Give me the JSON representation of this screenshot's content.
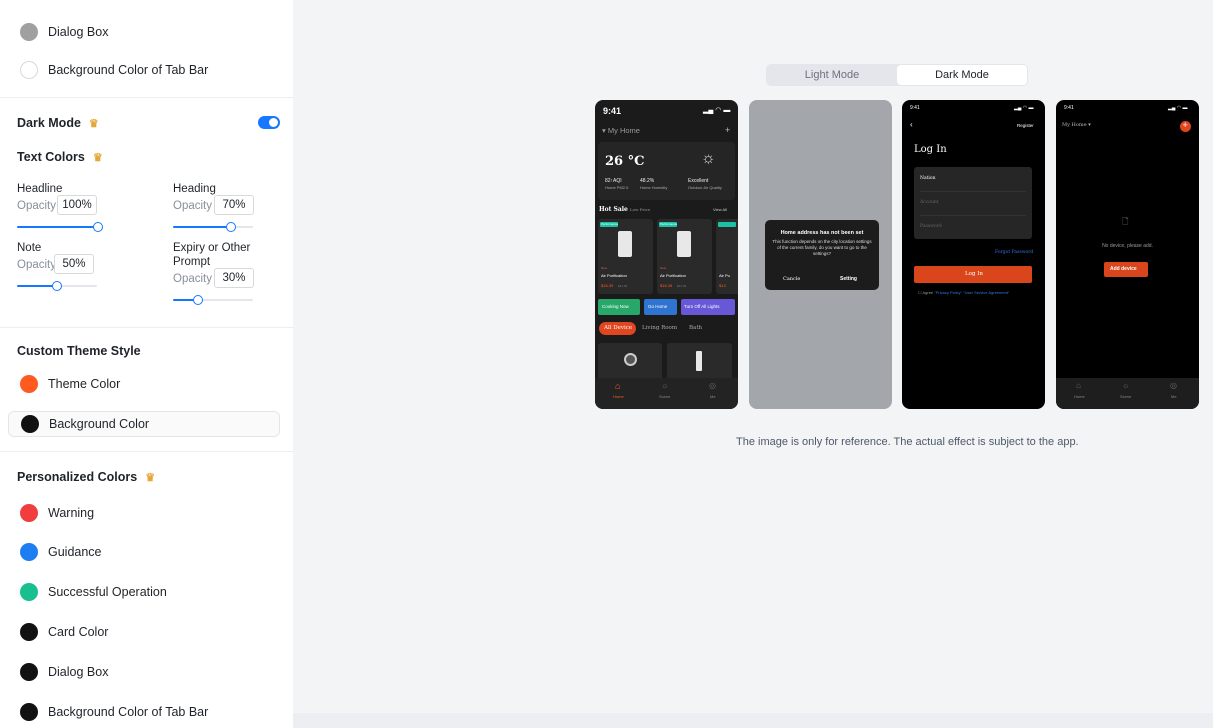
{
  "colors": {
    "accent": "#1677ff",
    "theme": "#ff5a1f",
    "warning": "#f03e3e",
    "guidance": "#1c7ef2",
    "success": "#18c08f",
    "dark": "#111111",
    "gray_swatch": "#a0a0a0"
  },
  "sidebar": {
    "top_items": [
      {
        "label": "Dialog Box",
        "icon": "gray-circle"
      },
      {
        "label": "Background Color of Tab Bar",
        "icon": "white-circle"
      }
    ],
    "dark_mode": {
      "title": "Dark Mode",
      "enabled": true
    },
    "text_colors": {
      "title": "Text Colors",
      "opacity_label": "Opacity",
      "headline": {
        "label": "Headline",
        "value": "100%",
        "level": 100
      },
      "heading": {
        "label": "Heading",
        "value": "70%",
        "level": 70
      },
      "note": {
        "label": "Note",
        "value": "50%",
        "level": 50
      },
      "expiry": {
        "label": "Expiry or Other Prompt",
        "value": "30%",
        "level": 30
      }
    },
    "custom_theme": {
      "title": "Custom Theme Style",
      "theme_color": "Theme Color",
      "background_color": "Background Color"
    },
    "personalized": {
      "title": "Personalized Colors",
      "items": [
        "Warning",
        "Guidance",
        "Successful Operation",
        "Card Color",
        "Dialog Box",
        "Background Color of Tab Bar"
      ]
    }
  },
  "main": {
    "modes": [
      "Light Mode",
      "Dark Mode"
    ],
    "active_mode": "Dark Mode",
    "note": "The image is only for reference. The actual effect is subject to the app.",
    "phone1": {
      "time": "9:41",
      "home": "My Home",
      "temp": "26 °C",
      "aqi": "82↑AQI",
      "aqi_sub": "Home PM2.5",
      "humidity": "48.2%",
      "humidity_sub": "Home Humidity",
      "quality": "Excellent",
      "quality_sub": "Outdoor Air Quality",
      "hot_sale": "Hot Sale",
      "hot_sub": "Low Price",
      "view_all": "View All",
      "tag": "Performance",
      "new": "New",
      "product": "Air Purification",
      "product_short": "Air Pu",
      "price": "$16.39",
      "price_short": "$13",
      "old_price": "$21.00",
      "scenes": [
        "Cooking Now",
        "Go Home",
        "Turn Off All Lights"
      ],
      "rooms": [
        "All Device",
        "Living Room",
        "Bath"
      ],
      "tabs": [
        "Home",
        "Scene",
        "Me"
      ]
    },
    "phone2": {
      "title": "Home address has not been set",
      "body": "This function depends on the city location settings of the current family, do you want to go to the settings?",
      "cancel": "Cancle",
      "ok": "Setting"
    },
    "phone3": {
      "time": "9:41",
      "register": "Register",
      "title": "Log In",
      "nation": "Nation",
      "account": "Account",
      "password": "Password",
      "forgot": "Forgot Password",
      "login": "Log In",
      "agree": "Agree",
      "agree_links": "\"Privacy Policy\" \"User Service Agreement\""
    },
    "phone4": {
      "time": "9:41",
      "home": "My Home",
      "empty": "No device, please add.",
      "add": "Add device",
      "tabs": [
        "Home",
        "Scene",
        "Me"
      ]
    }
  }
}
